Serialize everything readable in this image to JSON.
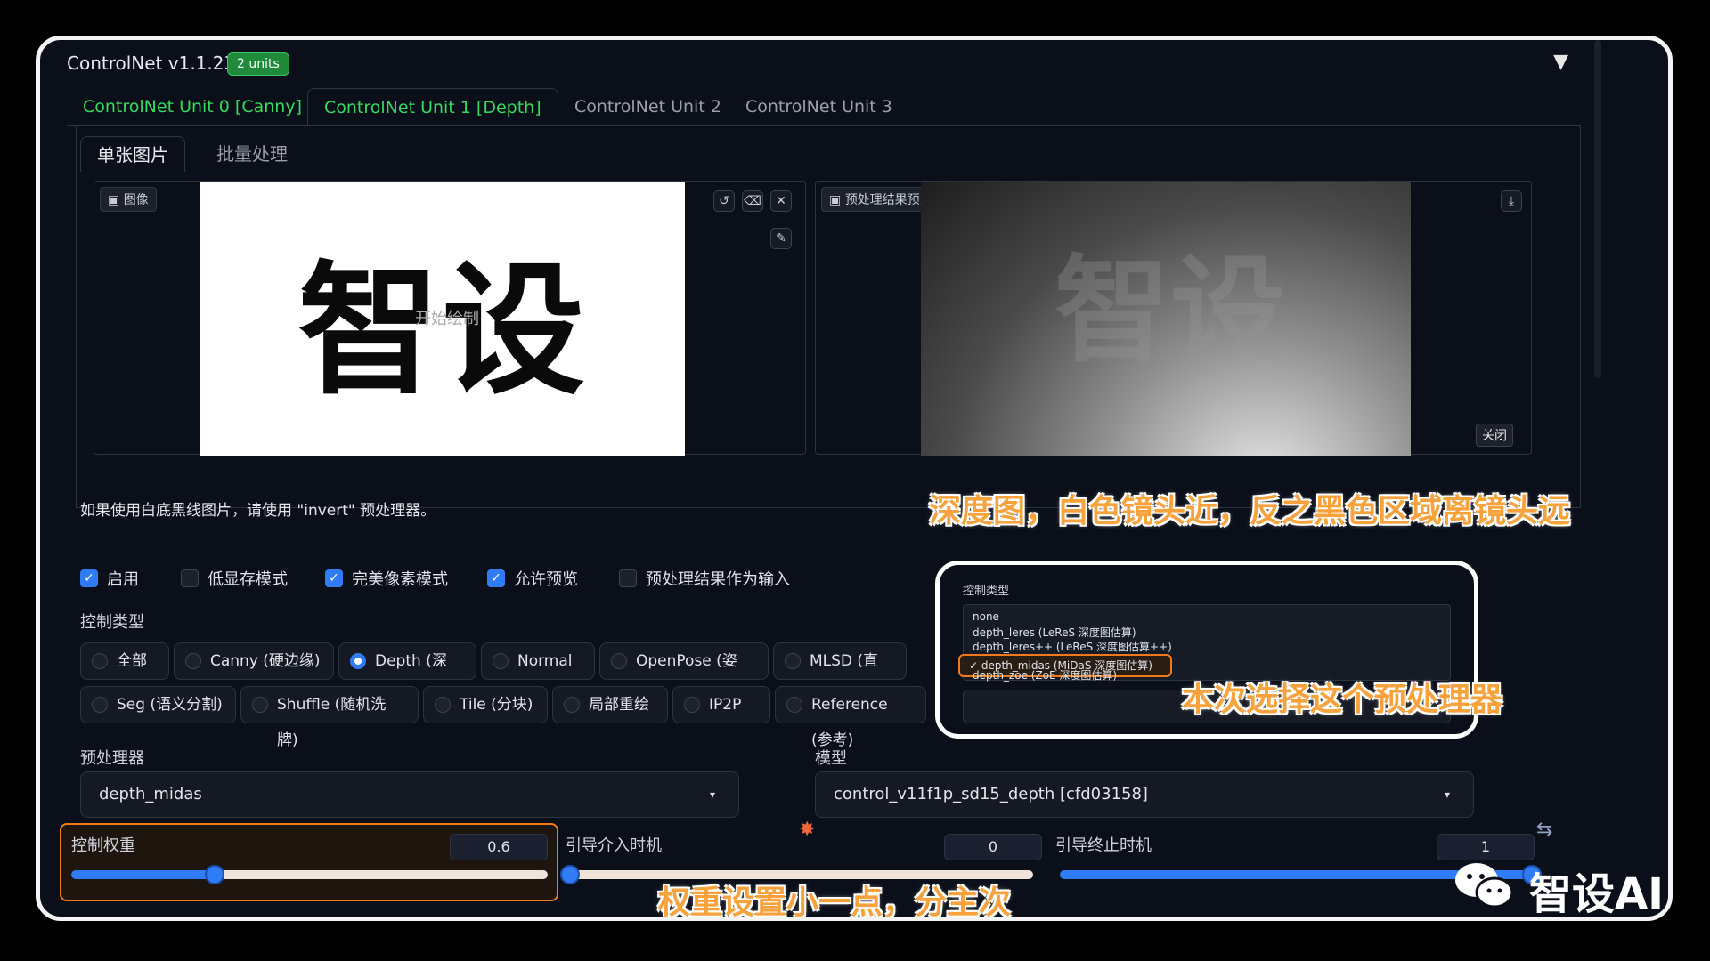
{
  "header": {
    "title": "ControlNet v1.1.238",
    "badge": "2 units",
    "collapse_icon": "▼"
  },
  "tabs": [
    {
      "label": "ControlNet Unit 0 [Canny]",
      "state": "enabled"
    },
    {
      "label": "ControlNet Unit 1 [Depth]",
      "state": "active"
    },
    {
      "label": "ControlNet Unit 2",
      "state": "inactive"
    },
    {
      "label": "ControlNet Unit 3",
      "state": "inactive"
    }
  ],
  "subtabs": [
    "单张图片",
    "批量处理"
  ],
  "image_panel": {
    "label": "图像",
    "content_text": "智设",
    "hint": "开始绘制",
    "tools": [
      "↺",
      "⌫",
      "✕",
      "✎"
    ]
  },
  "preview_panel": {
    "label": "预处理结果预览",
    "ghost_text": "智设",
    "download_icon": "⤓",
    "close_label": "关闭"
  },
  "invert_note": "如果使用白底黑线图片，请使用 \"invert\" 预处理器。",
  "annotations": {
    "depth_explain": "深度图，白色镜头近，反之黑色区域离镜头远",
    "select_preprocessor": "本次选择这个预处理器",
    "weight_hint": "权重设置小一点，分主次"
  },
  "checkboxes": [
    {
      "label": "启用",
      "checked": true
    },
    {
      "label": "低显存模式",
      "checked": false
    },
    {
      "label": "完美像素模式",
      "checked": true
    },
    {
      "label": "允许预览",
      "checked": true
    },
    {
      "label": "预处理结果作为输入",
      "checked": false
    }
  ],
  "control_type": {
    "label": "控制类型",
    "row1": [
      "全部",
      "Canny (硬边缘)",
      "Depth (深度)",
      "Normal",
      "OpenPose (姿态)",
      "MLSD (直线)"
    ],
    "row2": [
      "Seg (语义分割)",
      "Shuffle (随机洗牌)",
      "Tile (分块)",
      "局部重绘",
      "IP2P",
      "Reference (参考)"
    ],
    "selected": "Depth (深度)"
  },
  "popup": {
    "title": "控制类型",
    "options": [
      "none",
      "depth_leres (LeReS 深度图估算)",
      "depth_leres++ (LeReS 深度图估算++)",
      "✓ depth_midas (MiDaS 深度图估算)",
      "depth_zoe (ZoE 深度图估算)"
    ],
    "dropdown_arrow": "▾"
  },
  "preprocessor": {
    "label": "预处理器",
    "value": "depth_midas",
    "arrow": "▾"
  },
  "model": {
    "label": "模型",
    "value": "control_v11f1p_sd15_depth [cfd03158]",
    "arrow": "▾"
  },
  "sliders": {
    "weight": {
      "label": "控制权重",
      "value": "0.6",
      "fraction": 0.3
    },
    "start": {
      "label": "引导介入时机",
      "value": "0",
      "fraction": 0.0
    },
    "end": {
      "label": "引导终止时机",
      "value": "1",
      "fraction": 1.0
    }
  },
  "watermark": {
    "text": "智设AI"
  },
  "colors": {
    "background": "#0b0f19",
    "accent_green": "#37d95f",
    "accent_blue": "#2f7cf6",
    "annotation_orange": "#f7a23c"
  }
}
